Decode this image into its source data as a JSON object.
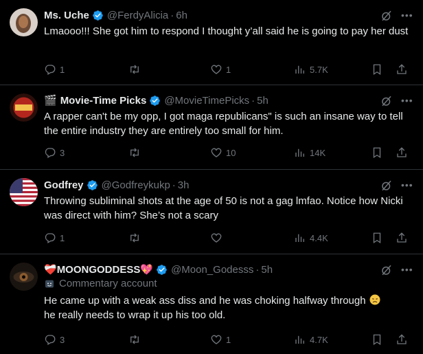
{
  "tweets": [
    {
      "name": "Ms. Uche",
      "name_emoji": "",
      "name_emoji_after": "",
      "handle": "@FerdyAlicia",
      "time": "6h",
      "sub": "",
      "text": "Lmaooo!!! She got him to respond I thought y’all said he is going to pay her dust",
      "replies": "1",
      "retweets": "",
      "likes": "1",
      "views": "5.7K"
    },
    {
      "name": "Movie-Time Picks",
      "name_emoji": "🎬",
      "name_emoji_after": "",
      "handle": "@MovieTimePicks",
      "time": "5h",
      "sub": "",
      "text": "A rapper can't be my opp, I got maga republicans\" is such an insane way to tell the entire industry they are entirely too small for him.",
      "replies": "3",
      "retweets": "",
      "likes": "10",
      "views": "14K"
    },
    {
      "name": "Godfrey",
      "name_emoji": "",
      "name_emoji_after": "",
      "handle": "@Godfreykukp",
      "time": "3h",
      "sub": "",
      "text": "Throwing subliminal shots at the age of 50 is not a gag lmfao. Notice how Nicki was direct with him? She’s not a scary",
      "replies": "1",
      "retweets": "",
      "likes": "",
      "views": "4.4K"
    },
    {
      "name": "MOONGODDESS",
      "name_emoji": "❤️‍🩹",
      "name_emoji_after": "💖",
      "handle": "@Moon_Godesss",
      "time": "5h",
      "sub": "Commentary account",
      "text": "He came up with a weak ass diss and he was choking halfway through",
      "text2": "he really needs to wrap it up his too old.",
      "replies": "3",
      "retweets": "",
      "likes": "1",
      "views": "4.7K"
    }
  ],
  "separator": "·"
}
